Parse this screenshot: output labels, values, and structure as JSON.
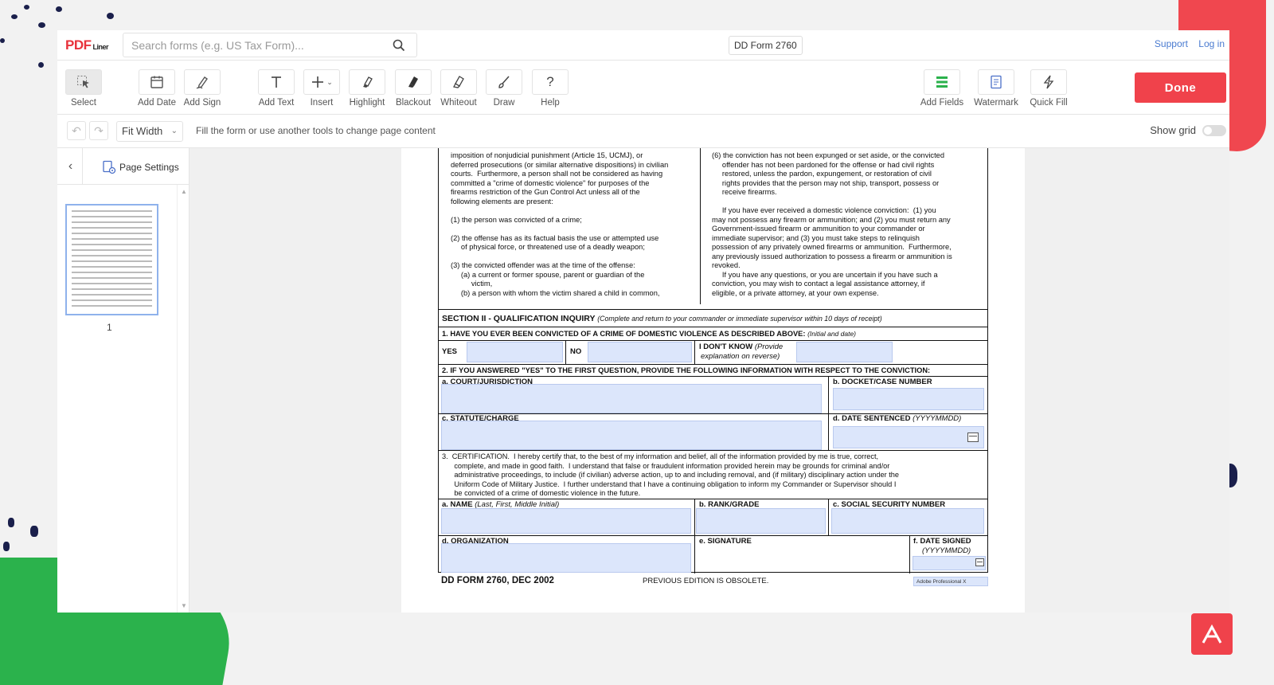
{
  "header": {
    "logo_main": "PDF",
    "logo_sub": "Liner",
    "search_placeholder": "Search forms (e.g. US Tax Form)...",
    "document_title": "DD Form 2760",
    "links": [
      "Support",
      "Log in"
    ]
  },
  "toolbar": {
    "left_tools": [
      "Select",
      "Add Date",
      "Add Sign",
      "Add Text",
      "Insert",
      "Highlight",
      "Blackout",
      "Whiteout",
      "Draw",
      "Help"
    ],
    "right_tools": [
      "Add Fields",
      "Watermark",
      "Quick Fill"
    ],
    "done_label": "Done"
  },
  "subbar": {
    "zoom": "Fit Width",
    "hint": "Fill the form or use another tools to change page content",
    "grid_label": "Show grid",
    "grid_enabled": false
  },
  "sidebar": {
    "title": "Page Settings",
    "page_number": "1"
  },
  "form": {
    "left_col": [
      "imposition of nonjudicial punishment (Article 15, UCMJ), or",
      "deferred prosecutions (or similar alternative dispositions) in civilian",
      "courts.  Furthermore, a person shall not be considered as having",
      "committed a \"crime of domestic violence\" for purposes of the",
      "firearms restriction of the Gun Control Act unless all of the",
      "following elements are present:",
      "",
      "(1) the person was convicted of a crime;",
      "",
      "(2) the offense has as its factual basis the use or attempted use",
      "     of physical force, or threatened use of a deadly weapon;",
      "",
      "(3) the convicted offender was at the time of the offense:",
      "     (a) a current or former spouse, parent or guardian of the",
      "          victim,",
      "     (b) a person with whom the victim shared a child in common,"
    ],
    "right_col": [
      "(6) the conviction has not been expunged or set aside, or the convicted",
      "     offender has not been pardoned for the offense or had civil rights",
      "     restored, unless the pardon, expungement, or restoration of civil",
      "     rights provides that the person may not ship, transport, possess or",
      "     receive firearms.",
      "",
      "     If you have ever received a domestic violence conviction:  (1) you",
      "may not possess any firearm or ammunition; and (2) you must return any",
      "Government-issued firearm or ammunition to your commander or",
      "immediate supervisor; and (3) you must take steps to relinquish",
      "possession of any privately owned firearms or ammunition.  Furthermore,",
      "any previously issued authorization to possess a firearm or ammunition is",
      "revoked.",
      "     If you have any questions, or you are uncertain if you have such a",
      "conviction, you may wish to contact a legal assistance attorney, if",
      "eligible, or a private attorney, at your own expense."
    ],
    "section2_title": "SECTION II - QUALIFICATION INQUIRY",
    "section2_note": "(Complete and return to your commander or immediate supervisor within 10 days of receipt)",
    "q1": "1.  HAVE YOU EVER BEEN CONVICTED OF A CRIME OF DOMESTIC VIOLENCE AS DESCRIBED ABOVE:",
    "q1_note": "(Initial and date)",
    "yes": "YES",
    "no": "NO",
    "dont_know": "I DON'T KNOW",
    "dont_know_note1": "(Provide",
    "dont_know_note2": "explanation on reverse)",
    "q2": "2.  IF YOU ANSWERED \"YES\" TO THE FIRST QUESTION, PROVIDE THE FOLLOWING INFORMATION WITH RESPECT TO THE CONVICTION:",
    "q2a": "a.  COURT/JURISDICTION",
    "q2b": "b. DOCKET/CASE NUMBER",
    "q2c": "c.  STATUTE/CHARGE",
    "q2d": "d. DATE SENTENCED",
    "q2d_note": "(YYYYMMDD)",
    "q3_lines": [
      "3.  CERTIFICATION.  I hereby certify that, to the best of my information and belief, all of the information provided by me is true, correct,",
      "      complete, and made in good faith.  I understand that false or fraudulent information provided herein may be grounds for criminal and/or",
      "      administrative proceedings, to include (if civilian) adverse action, up to and including removal, and (if military) disciplinary action under the",
      "      Uniform Code of Military Justice.  I further understand that I have a continuing obligation to inform my Commander or Supervisor should I",
      "      be convicted of a crime of domestic violence in the future."
    ],
    "q3a": "a.  NAME",
    "q3a_note": "(Last, First, Middle Initial)",
    "q3b": "b.  RANK/GRADE",
    "q3c": "c.  SOCIAL SECURITY NUMBER",
    "q3d": "d.  ORGANIZATION",
    "q3e": "e.  SIGNATURE",
    "q3f": "f. DATE SIGNED",
    "q3f_note": "(YYYYMMDD)",
    "footer_form": "DD FORM 2760, DEC 2002",
    "footer_prev": "PREVIOUS EDITION IS OBSOLETE.",
    "footer_badge": "Adobe Professional X"
  },
  "colors": {
    "brand_red": "#f0424b",
    "field_blue": "#dce6fb",
    "link_blue": "#4a7bd0",
    "deco_green": "#2bb24c"
  }
}
